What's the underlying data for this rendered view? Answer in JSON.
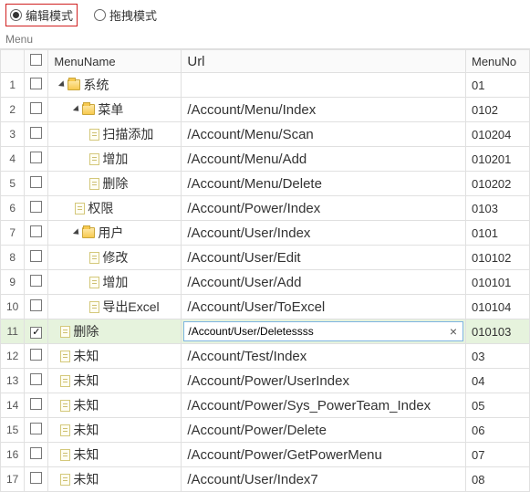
{
  "modes": {
    "edit": "编辑模式",
    "drag": "拖拽模式"
  },
  "menuHeader": "Menu",
  "columns": {
    "menuName": "MenuName",
    "url": "Url",
    "menuNo": "MenuNo"
  },
  "editingRow": 11,
  "rows": [
    {
      "n": 1,
      "indent": 0,
      "expander": true,
      "icon": "folder",
      "name": "系统",
      "url": "",
      "menuNo": "01"
    },
    {
      "n": 2,
      "indent": 1,
      "expander": true,
      "icon": "folder",
      "name": "菜单",
      "url": "/Account/Menu/Index",
      "menuNo": "0102"
    },
    {
      "n": 3,
      "indent": 2,
      "expander": false,
      "icon": "file",
      "name": "扫描添加",
      "url": "/Account/Menu/Scan",
      "menuNo": "010204"
    },
    {
      "n": 4,
      "indent": 2,
      "expander": false,
      "icon": "file",
      "name": "增加",
      "url": "/Account/Menu/Add",
      "menuNo": "010201"
    },
    {
      "n": 5,
      "indent": 2,
      "expander": false,
      "icon": "file",
      "name": "删除",
      "url": "/Account/Menu/Delete",
      "menuNo": "010202"
    },
    {
      "n": 6,
      "indent": 1,
      "expander": false,
      "icon": "file",
      "name": "权限",
      "url": "/Account/Power/Index",
      "menuNo": "0103"
    },
    {
      "n": 7,
      "indent": 1,
      "expander": true,
      "icon": "folder",
      "name": "用户",
      "url": "/Account/User/Index",
      "menuNo": "0101"
    },
    {
      "n": 8,
      "indent": 2,
      "expander": false,
      "icon": "file",
      "name": "修改",
      "url": "/Account/User/Edit",
      "menuNo": "010102"
    },
    {
      "n": 9,
      "indent": 2,
      "expander": false,
      "icon": "file",
      "name": "增加",
      "url": "/Account/User/Add",
      "menuNo": "010101"
    },
    {
      "n": 10,
      "indent": 2,
      "expander": false,
      "icon": "file",
      "name": "导出Excel",
      "url": "/Account/User/ToExcel",
      "menuNo": "010104"
    },
    {
      "n": 11,
      "indent": 0,
      "expander": false,
      "icon": "file",
      "name": "删除",
      "url": "/Account/User/Deletessss",
      "menuNo": "010103",
      "checked": true
    },
    {
      "n": 12,
      "indent": 0,
      "expander": false,
      "icon": "file",
      "name": "未知",
      "url": "/Account/Test/Index",
      "menuNo": "03"
    },
    {
      "n": 13,
      "indent": 0,
      "expander": false,
      "icon": "file",
      "name": "未知",
      "url": "/Account/Power/UserIndex",
      "menuNo": "04"
    },
    {
      "n": 14,
      "indent": 0,
      "expander": false,
      "icon": "file",
      "name": "未知",
      "url": "/Account/Power/Sys_PowerTeam_Index",
      "menuNo": "05"
    },
    {
      "n": 15,
      "indent": 0,
      "expander": false,
      "icon": "file",
      "name": "未知",
      "url": "/Account/Power/Delete",
      "menuNo": "06"
    },
    {
      "n": 16,
      "indent": 0,
      "expander": false,
      "icon": "file",
      "name": "未知",
      "url": "/Account/Power/GetPowerMenu",
      "menuNo": "07"
    },
    {
      "n": 17,
      "indent": 0,
      "expander": false,
      "icon": "file",
      "name": "未知",
      "url": "/Account/User/Index7",
      "menuNo": "08"
    }
  ]
}
